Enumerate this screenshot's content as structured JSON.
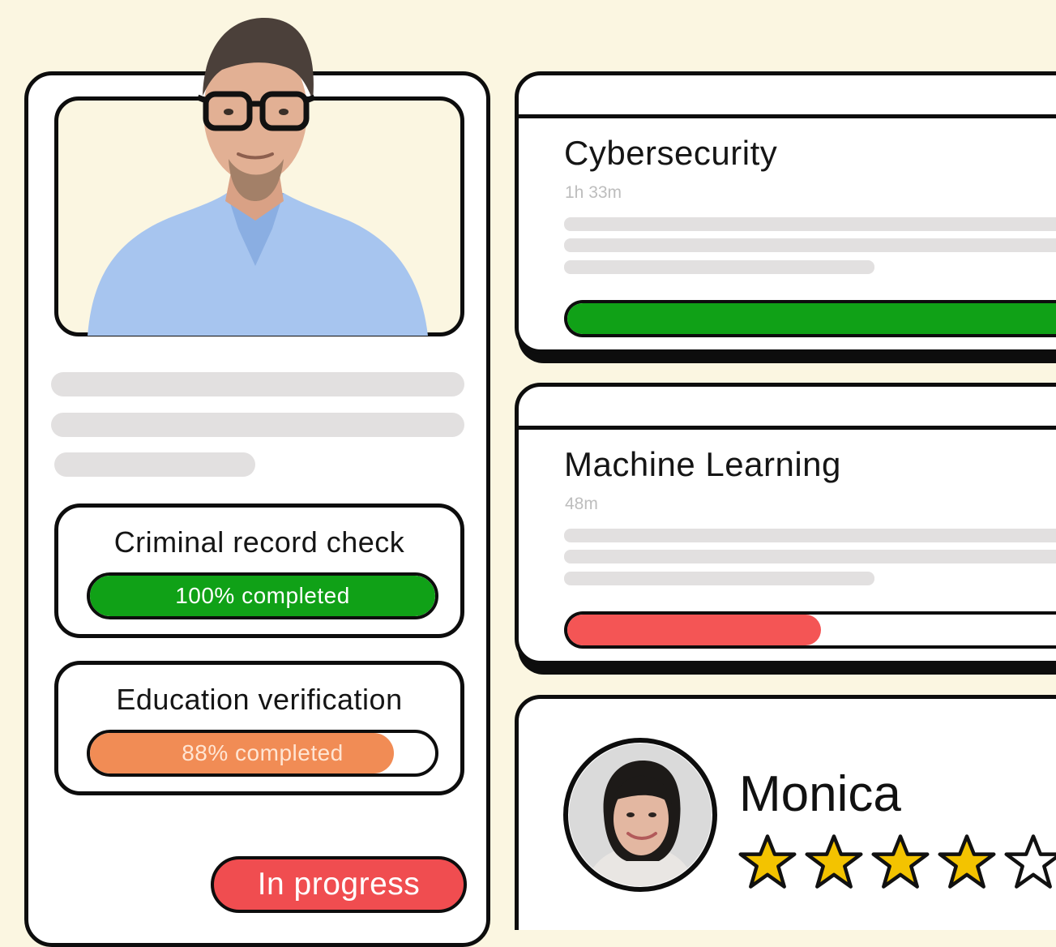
{
  "profile": {
    "checks": [
      {
        "title": "Criminal record check",
        "progress": 100,
        "label": "100% completed",
        "color": "#10a117"
      },
      {
        "title": "Education verification",
        "progress": 88,
        "label": "88% completed",
        "color": "#f18c55"
      }
    ],
    "status": "In progress",
    "status_color": "#f04d50"
  },
  "courses": [
    {
      "title": "Cybersecurity",
      "duration": "1h 33m",
      "progress": 100,
      "bar_color": "#10a117"
    },
    {
      "title": "Machine Learning",
      "duration": "48m",
      "progress": 45,
      "bar_color": "#f45555"
    }
  ],
  "review": {
    "name": "Monica",
    "rating": 4,
    "max_rating": 5,
    "star_color": "#f3c300"
  },
  "icons": {
    "profile_photo": "man-portrait",
    "review_avatar": "woman-portrait",
    "rating": "star-icon"
  }
}
